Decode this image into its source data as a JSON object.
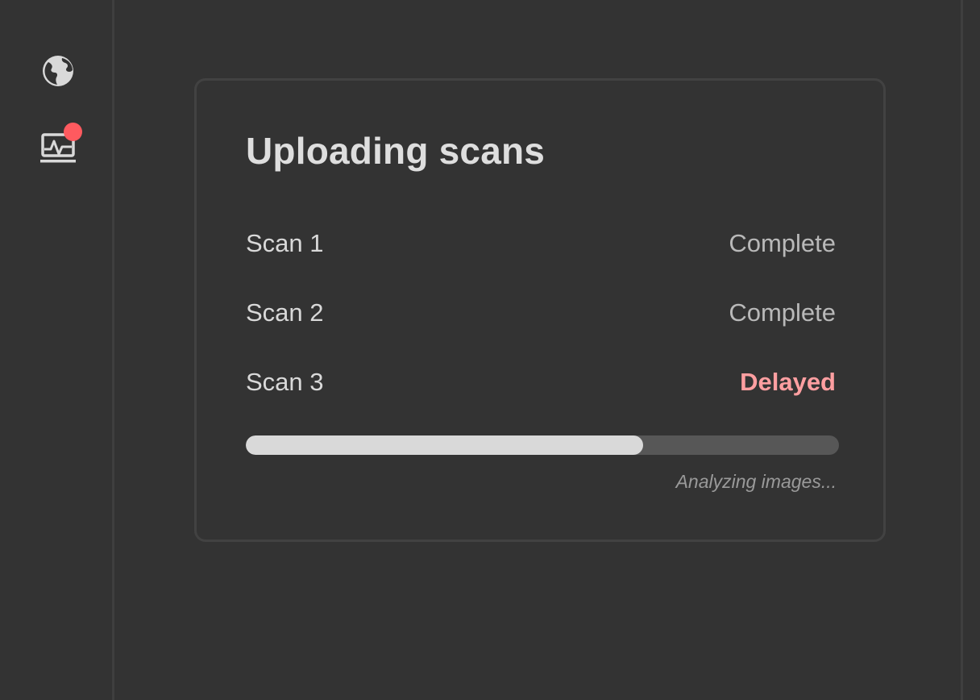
{
  "sidebar": {
    "items": [
      {
        "icon": "globe-icon"
      },
      {
        "icon": "monitor-activity-icon",
        "has_notification": true
      }
    ],
    "notification_color": "#ff5a5f"
  },
  "card": {
    "title": "Uploading scans",
    "rows": [
      {
        "label": "Scan 1",
        "status": "Complete"
      },
      {
        "label": "Scan 2",
        "status": "Complete"
      },
      {
        "label": "Scan 3",
        "status": "Delayed"
      }
    ],
    "progress": {
      "value": 0.67,
      "caption": "Analyzing images..."
    }
  },
  "colors": {
    "background": "#333333",
    "delayed": "#ff9fa1",
    "progress_fill": "#d9d9d9",
    "progress_track": "#575757"
  }
}
